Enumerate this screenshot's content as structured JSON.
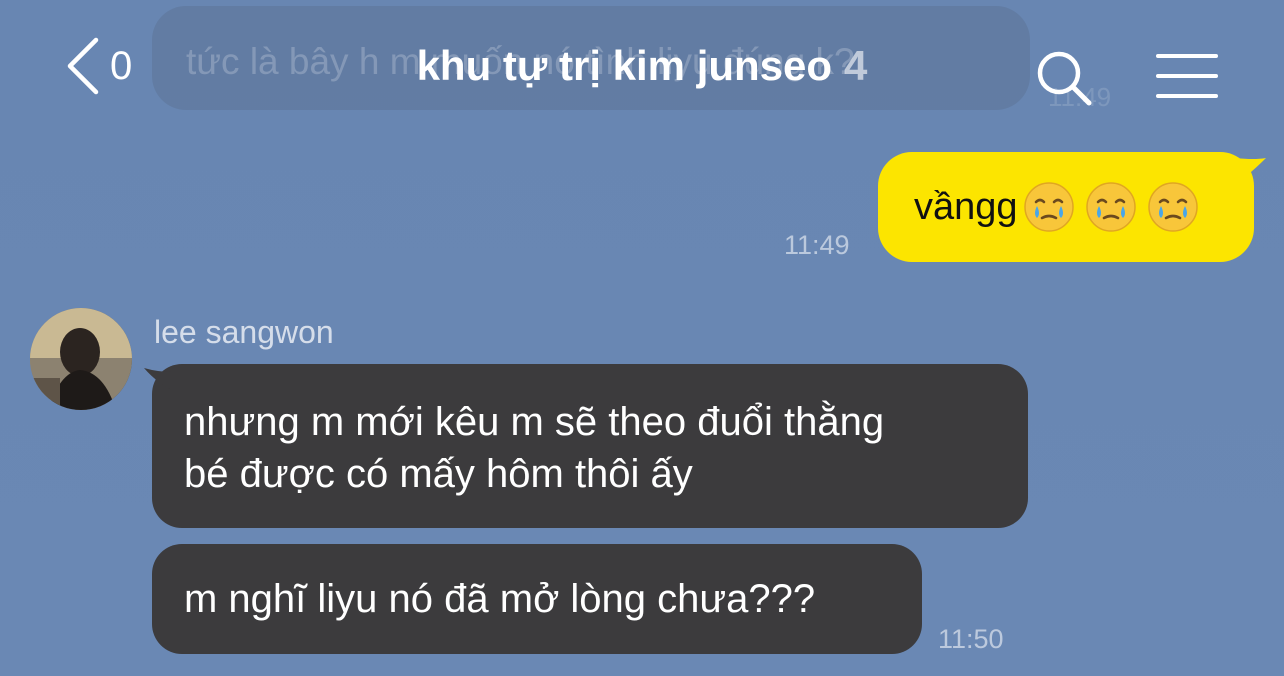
{
  "header": {
    "back_count": "0",
    "title": "khu tự trị kim junseo",
    "member_count": "4",
    "back_icon": "chevron-left-icon",
    "search_icon": "search-icon",
    "menu_icon": "hamburger-menu-icon"
  },
  "ghost_message": {
    "text": "tức là bây h m muốn nó tình liyu đúng k?",
    "time": "11:49"
  },
  "messages": [
    {
      "direction": "sent",
      "text": "vầngg",
      "emojis": [
        "face-holding-back-tears",
        "face-holding-back-tears",
        "face-holding-back-tears"
      ],
      "time": "11:49"
    },
    {
      "direction": "received",
      "sender": "lee sangwon",
      "line1": "nhưng m mới kêu m sẽ theo đuổi thằng",
      "line2": "bé được có mấy hôm thôi ấy"
    },
    {
      "direction": "received",
      "text": "m nghĩ liyu nó đã mở lòng chưa???",
      "time": "11:50"
    }
  ],
  "colors": {
    "background": "#6a87b3",
    "sent_bubble": "#fce500",
    "received_bubble": "#3c3b3d"
  }
}
